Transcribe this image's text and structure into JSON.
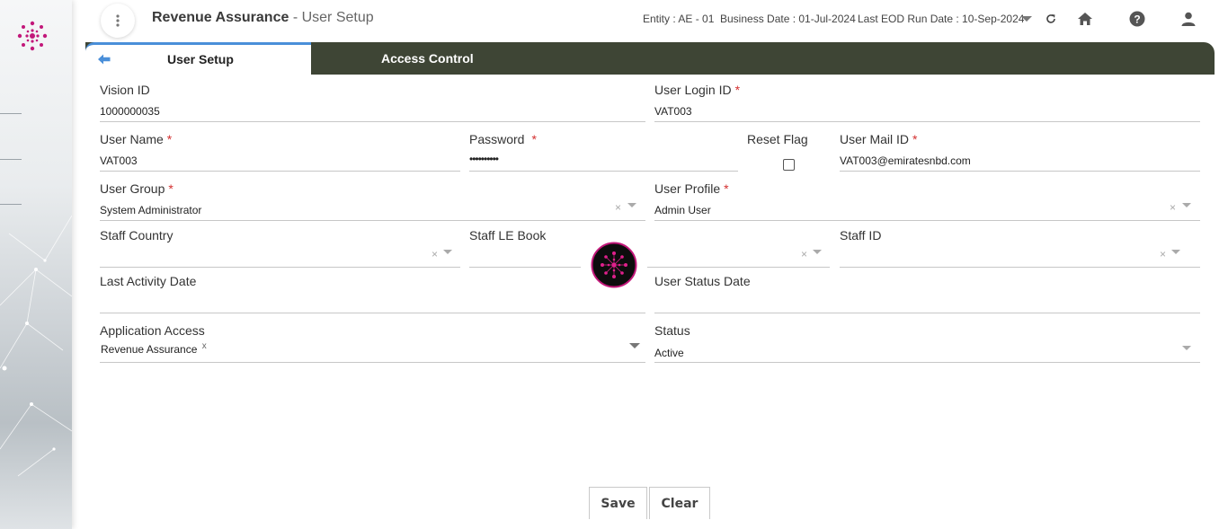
{
  "header": {
    "app_name": "Revenue Assurance",
    "page_suffix": " - User Setup",
    "entity": "Entity : AE - 01",
    "business_date": "Business Date : 01-Jul-2024",
    "last_eod": "Last EOD Run Date : 10-Sep-2024"
  },
  "tabs": {
    "user_setup": "User Setup",
    "access_control": "Access Control"
  },
  "form": {
    "vision_id": {
      "label": "Vision ID",
      "value": "1000000035"
    },
    "user_login_id": {
      "label": "User Login ID",
      "value": "VAT003"
    },
    "user_name": {
      "label": "User Name",
      "value": "VAT003"
    },
    "password": {
      "label": "Password",
      "value": "••••••••••"
    },
    "reset_flag": {
      "label": "Reset Flag",
      "checked": false
    },
    "user_mail_id": {
      "label": "User Mail ID",
      "value": "VAT003@emiratesnbd.com"
    },
    "user_group": {
      "label": "User Group",
      "value": "System Administrator"
    },
    "user_profile": {
      "label": "User Profile",
      "value": "Admin User"
    },
    "staff_country": {
      "label": "Staff Country",
      "value": ""
    },
    "staff_le_book": {
      "label": "Staff LE Book",
      "value": ""
    },
    "staff_id": {
      "label": "Staff ID",
      "value": ""
    },
    "last_activity_date": {
      "label": "Last Activity Date",
      "value": ""
    },
    "user_status_date": {
      "label": "User Status Date",
      "value": ""
    },
    "application_access": {
      "label": "Application Access",
      "chip": "Revenue Assurance",
      "chip_remove": "x"
    },
    "status": {
      "label": "Status",
      "value": "Active"
    },
    "required_mark": "*",
    "clear_symbol": "×"
  },
  "buttons": {
    "save": "Save",
    "clear": "Clear"
  },
  "colors": {
    "tab_bar": "#3e4535",
    "accent": "#4a8fd9",
    "brand": "#c2187a",
    "required": "#d32f2f"
  }
}
